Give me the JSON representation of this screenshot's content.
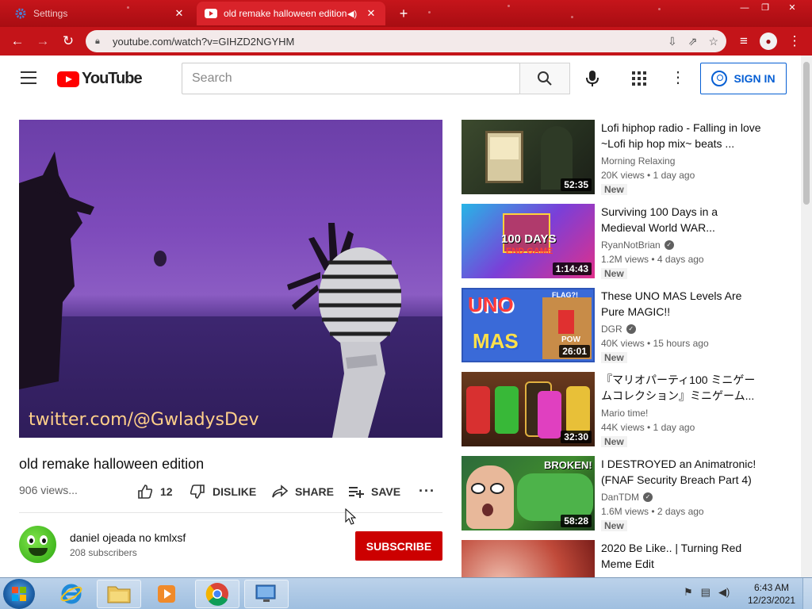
{
  "browser": {
    "tabs": [
      {
        "title": "Settings",
        "active": false
      },
      {
        "title": "old remake halloween edition",
        "active": true
      }
    ],
    "url": "youtube.com/watch?v=GIHZD2NGYHM",
    "accent_color": "#c41419"
  },
  "masthead": {
    "logo_text": "YouTube",
    "search_placeholder": "Search",
    "sign_in_label": "SIGN IN"
  },
  "video": {
    "title": "old remake halloween edition",
    "views": "906 views...",
    "watermark": "twitter.com/@GwladysDev",
    "like_count": "12",
    "dislike_label": "DISLIKE",
    "share_label": "SHARE",
    "save_label": "SAVE",
    "channel_name": "daniel ojeada no kmlxsf",
    "subscribers": "208 subscribers",
    "subscribe_label": "SUBSCRIBE"
  },
  "recommendations": [
    {
      "title": "Lofi hiphop radio - Falling in love ~Lofi hip hop mix~ beats ...",
      "channel": "Morning Relaxing",
      "verified": false,
      "meta": "20K views • 1 day ago",
      "badge": "New",
      "duration": "52:35"
    },
    {
      "title": "Surviving 100 Days in a Medieval World WAR...",
      "channel": "RyanNotBrian",
      "verified": true,
      "meta": "1.2M views • 4 days ago",
      "badge": "New",
      "duration": "1:14:43"
    },
    {
      "title": "These UNO MAS Levels Are Pure MAGIC!!",
      "channel": "DGR",
      "verified": true,
      "meta": "40K views • 15 hours ago",
      "badge": "New",
      "duration": "26:01"
    },
    {
      "title": "『マリオパーティ100 ミニゲームコレクション』ミニゲーム...",
      "channel": "Mario time!",
      "verified": false,
      "meta": "44K views • 1 day ago",
      "badge": "New",
      "duration": "32:30"
    },
    {
      "title": "I DESTROYED an Animatronic! (FNAF Security Breach Part 4)",
      "channel": "DanTDM",
      "verified": true,
      "meta": "1.6M views • 2 days ago",
      "badge": "New",
      "duration": "58:28"
    },
    {
      "title": "2020 Be Like.. | Turning Red Meme Edit",
      "channel": "",
      "verified": false,
      "meta": "",
      "badge": "",
      "duration": ""
    }
  ],
  "thumb_text": {
    "rec1_line1": "100 DAYS",
    "rec1_line2": "END GAME",
    "rec2_line1": "UNO",
    "rec2_line2": "MAS",
    "rec2_flag": "FLAG?!",
    "rec2_pow": "POW",
    "rec4_tag": "BROKEN!"
  },
  "taskbar": {
    "time": "6:43 AM",
    "date": "12/23/2021"
  }
}
